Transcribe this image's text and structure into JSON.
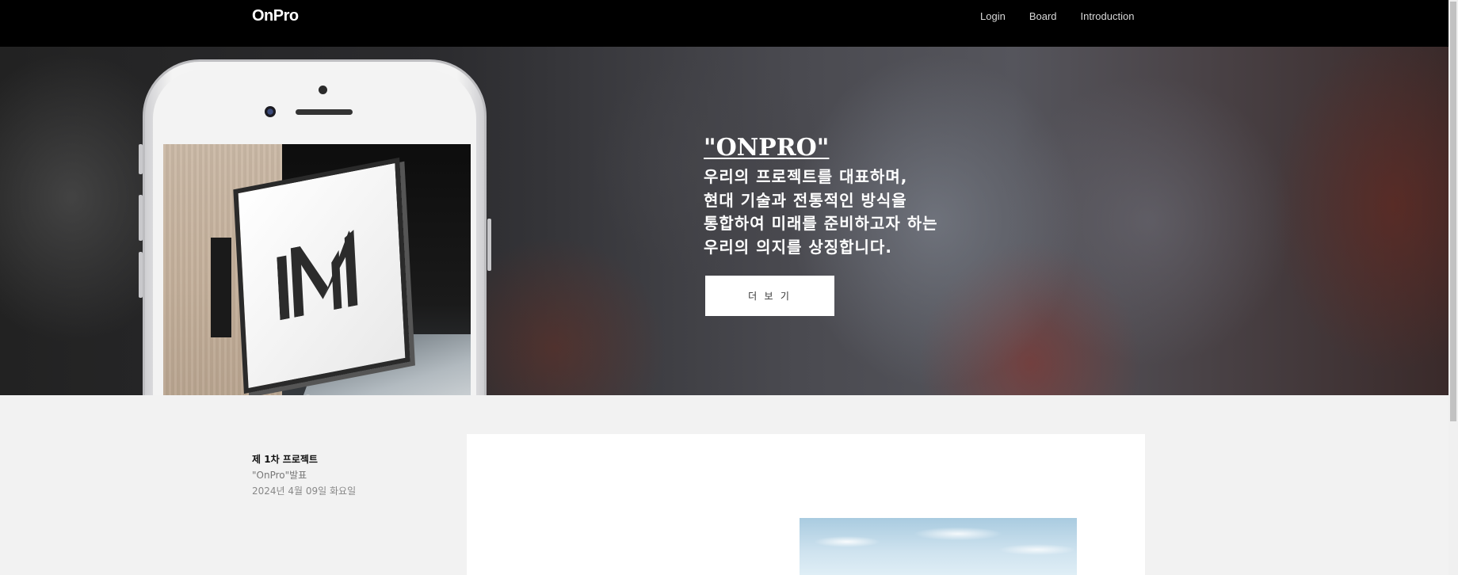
{
  "header": {
    "logo": "OnPro",
    "nav": [
      {
        "label": "Login"
      },
      {
        "label": "Board"
      },
      {
        "label": "Introduction"
      }
    ]
  },
  "hero": {
    "title": "\"ONPRO\"",
    "description": "우리의 프로젝트를 대표하며,\n현대 기술과 전통적인 방식을\n통합하여 미래를 준비하고자 하는\n우리의 의지를 상징합니다.",
    "more_button": "더 보 기"
  },
  "project": {
    "title": "제 1차 프로젝트",
    "subtitle": "\"OnPro\"발표",
    "date": "2024년 4월 09일 화요일"
  },
  "icons": {
    "logo_sign": "m-logo-icon"
  }
}
